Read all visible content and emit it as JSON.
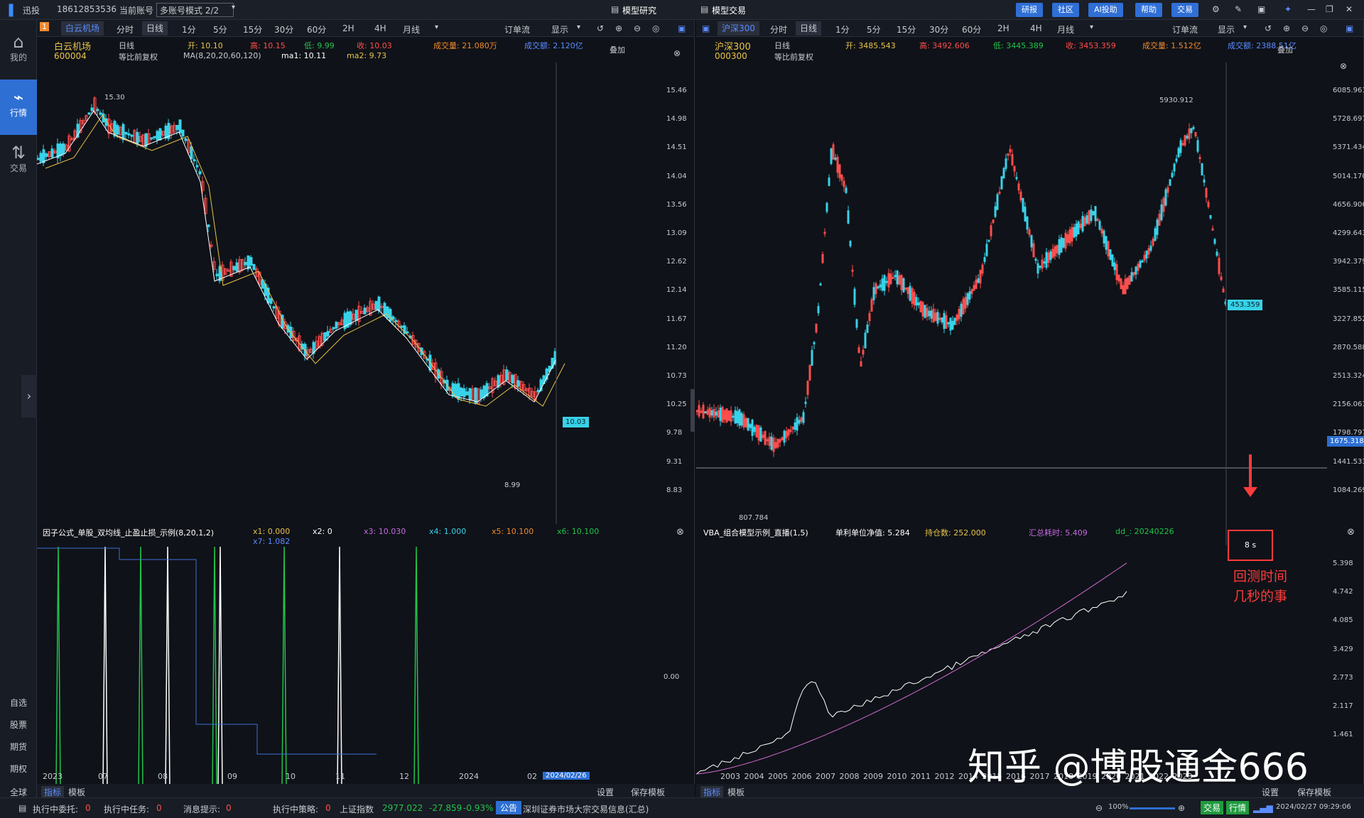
{
  "app": {
    "logo": "迅投",
    "phone": "18612853536",
    "account_label": "当前账号",
    "account_mode": "多账号模式 2/2",
    "tab_research": "模型研究",
    "tab_trading": "模型交易",
    "top_buttons": [
      "研报",
      "社区",
      "AI投助",
      "帮助",
      "交易"
    ]
  },
  "sidebar": {
    "items": [
      {
        "label": "我的",
        "icon": "home-icon"
      },
      {
        "label": "行情",
        "icon": "chart-icon"
      },
      {
        "label": "交易",
        "icon": "trade-icon"
      }
    ],
    "bottom": [
      "自选",
      "股票",
      "期货",
      "期权",
      "全球"
    ]
  },
  "timeframes": [
    "分时",
    "日线",
    "1分",
    "5分",
    "15分",
    "30分",
    "60分",
    "2H",
    "4H",
    "月线"
  ],
  "extra_tabs": [
    "订单流",
    "显示"
  ],
  "left": {
    "tab_name": "白云机场",
    "stock_name": "白云机场",
    "code": "600004",
    "period": "日线",
    "adjust": "等比前复权",
    "open": "开: 10.10",
    "high": "高: 10.15",
    "low": "低: 9.99",
    "close": "收: 10.03",
    "volume": "成交量: 21.080万",
    "amount": "成交额: 2.120亿",
    "ma_label": "MA(8,20,20,60,120)",
    "ma1": "ma1: 10.11",
    "ma2": "ma2: 9.73",
    "overlay": "叠加",
    "peak_label": "15.30",
    "low_label": "8.99",
    "price_tag": "10.03",
    "y_ticks": [
      "15.46",
      "14.98",
      "14.51",
      "14.04",
      "13.56",
      "13.09",
      "12.62",
      "12.14",
      "11.67",
      "11.20",
      "10.73",
      "10.25",
      "9.78",
      "9.31",
      "8.83"
    ],
    "sub_title": "因子公式_单股_双均线_止盈止损_示例(8,20,1,2)",
    "x1": "x1: 0.000",
    "x2": "x2: 0",
    "x3": "x3: 10.030",
    "x4": "x4: 1.000",
    "x5": "x5: 10.100",
    "x6": "x6: 10.100",
    "x7": "x7: 1.082",
    "sub_y": "0.00",
    "x_ticks": [
      "2023",
      "07",
      "08",
      "09",
      "10",
      "11",
      "12",
      "2024",
      "02"
    ],
    "date_tag": "2024/02/26",
    "bottom_tabs": [
      "指标",
      "模板"
    ],
    "settings": "设置",
    "save_template": "保存模板"
  },
  "right": {
    "tab_name": "沪深300",
    "stock_name": "沪深300",
    "code": "000300",
    "period": "日线",
    "adjust": "等比前复权",
    "open": "开: 3485.543",
    "high": "高: 3492.606",
    "low": "低: 3445.389",
    "close": "收: 3453.359",
    "volume": "成交量: 1.512亿",
    "amount": "成交额: 2388.51亿",
    "overlay": "叠加",
    "peak_label": "5930.912",
    "low_label": "807.784",
    "price_tag": "453.359",
    "cross_tag": "1675.318",
    "y_ticks": [
      "6085.961",
      "5728.697",
      "5371.434",
      "5014.170",
      "4656.906",
      "4299.643",
      "3942.379",
      "3585.115",
      "3227.852",
      "2870.588",
      "2513.324",
      "2156.061",
      "1798.797",
      "1441.533",
      "1084.269"
    ],
    "sub_title": "VBA_组合模型示例_直播(1,5)",
    "nav": "单利单位净值: 5.284",
    "pos": "持仓数: 252.000",
    "elapsed": "汇总耗时: 5.409",
    "dd": "dd_: 20240226",
    "sub_y": [
      "5.398",
      "4.742",
      "4.085",
      "3.429",
      "2.773",
      "2.117",
      "1.461"
    ],
    "x_ticks": [
      "2003",
      "2004",
      "2005",
      "2006",
      "2007",
      "2008",
      "2009",
      "2010",
      "2011",
      "2012",
      "2014",
      "2015",
      "2016",
      "2017",
      "2018",
      "2019",
      "2020",
      "2021",
      "2022",
      "2023"
    ],
    "time_box": "8 s",
    "annotation_1": "回测时间",
    "annotation_2": "几秒的事",
    "bottom_tabs": [
      "指标",
      "模板"
    ],
    "settings": "设置",
    "save_template": "保存模板"
  },
  "watermark": "知乎 @博股通金666",
  "status": {
    "exec_order": "执行中委托:",
    "exec_order_n": "0",
    "exec_task": "执行中任务:",
    "exec_task_n": "0",
    "msg": "消息提示:",
    "msg_n": "0",
    "exec_strategy": "执行中策略:",
    "exec_strategy_n": "0",
    "index_name": "上证指数",
    "index_val": "2977.022",
    "index_chg": "-27.859",
    "index_pct": "-0.93%",
    "notice_tag": "公告",
    "notice": "深圳证券市场大宗交易信息(汇总)",
    "zoom": "100%",
    "trade_btn": "交易",
    "quote_btn": "行情",
    "clock": "2024/02/27 09:29:06"
  },
  "colors": {
    "up": "#ff4d4d",
    "down": "#38d2e8",
    "accent": "#2d6fd3",
    "ma1": "#ffffff",
    "ma2": "#e8c34b"
  }
}
